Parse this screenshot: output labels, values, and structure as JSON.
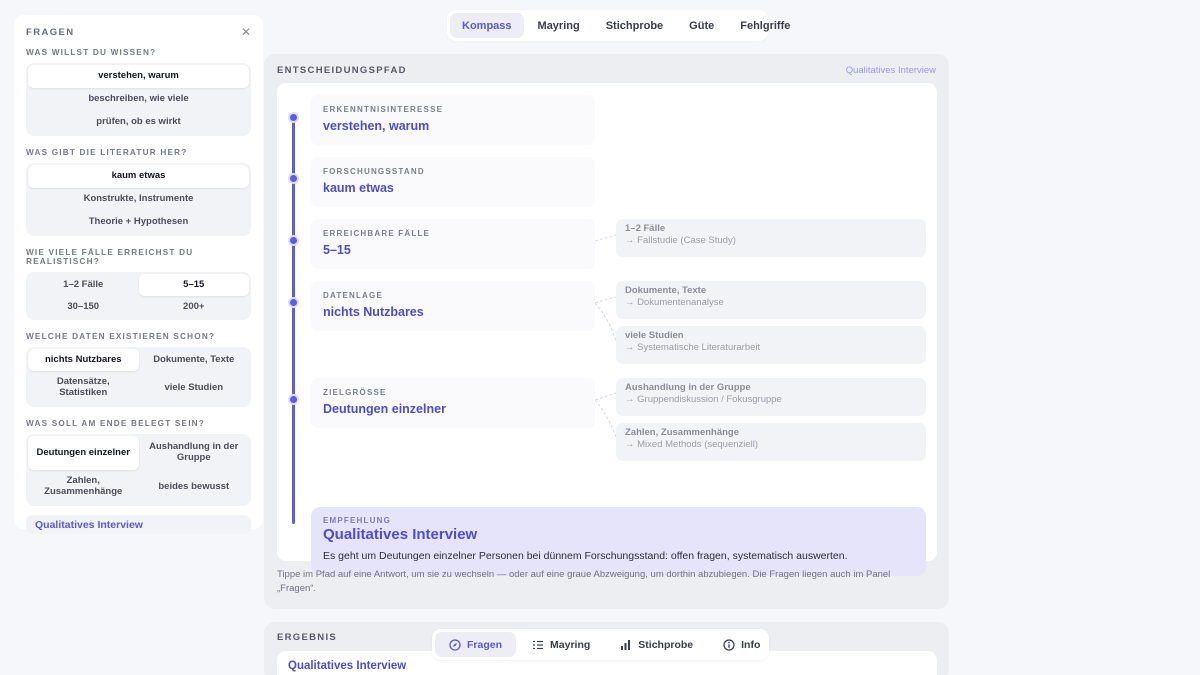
{
  "top_tabs": {
    "items": [
      "Kompass",
      "Mayring",
      "Stichprobe",
      "Güte",
      "Fehlgriffe"
    ],
    "active": "Kompass"
  },
  "panel": {
    "title": "FRAGEN",
    "close_icon": "close-icon",
    "questions": [
      {
        "label": "WAS WILLST DU WISSEN?",
        "options": [
          "verstehen, warum",
          "beschreiben, wie viele",
          "prüfen, ob es wirkt"
        ],
        "selected": "verstehen, warum"
      },
      {
        "label": "WAS GIBT DIE LITERATUR HER?",
        "options": [
          "kaum etwas",
          "Konstrukte, Instrumente",
          "Theorie + Hypothesen"
        ],
        "selected": "kaum etwas"
      },
      {
        "label": "WIE VIELE FÄLLE ERREICHST DU REALISTISCH?",
        "options": [
          "1–2 Fälle",
          "5–15",
          "30–150",
          "200+"
        ],
        "selected": "5–15"
      },
      {
        "label": "WELCHE DATEN EXISTIEREN SCHON?",
        "options": [
          "nichts Nutzbares",
          "Dokumente, Texte",
          "Datensätze, Statistiken",
          "viele Studien"
        ],
        "selected": "nichts Nutzbares"
      },
      {
        "label": "WAS SOLL AM ENDE BELEGT SEIN?",
        "options": [
          "Deutungen einzelner",
          "Aushandlung in der Gruppe",
          "Zahlen, Zusammenhänge",
          "beides bewusst"
        ],
        "selected": "Deutungen einzelner"
      }
    ],
    "result": "Qualitatives Interview"
  },
  "main": {
    "title": "ENTSCHEIDUNGSPFAD",
    "link": "Qualitatives Interview",
    "steps": [
      {
        "label": "ERKENNTNISINTERESSE",
        "value": "verstehen, warum"
      },
      {
        "label": "FORSCHUNGSSTAND",
        "value": "kaum etwas"
      },
      {
        "label": "ERREICHBARE FÄLLE",
        "value": "5–15"
      },
      {
        "label": "DATENLAGE",
        "value": "nichts Nutzbares"
      },
      {
        "label": "ZIELGRÖSSE",
        "value": "Deutungen einzelner"
      }
    ],
    "branches": [
      {
        "title": "1–2 Fälle",
        "target": "→ Fallstudie (Case Study)"
      },
      {
        "title": "Dokumente, Texte",
        "target": "→ Dokumentenanalyse"
      },
      {
        "title": "viele Studien",
        "target": "→ Systematische Literaturarbeit"
      },
      {
        "title": "Aushandlung in der Gruppe",
        "target": "→ Gruppendiskussion / Fokusgruppe"
      },
      {
        "title": "Zahlen, Zusammenhänge",
        "target": "→ Mixed Methods (sequenziell)"
      }
    ],
    "recommendation": {
      "label": "EMPFEHLUNG",
      "title": "Qualitatives Interview",
      "text": "Es geht um Deutungen einzelner Personen bei dünnem Forschungsstand: offen fragen, systematisch auswerten."
    },
    "hint": "Tippe im Pfad auf eine Antwort, um sie zu wechseln — oder auf eine graue Abzweigung, um dorthin abzubiegen. Die Fragen liegen auch im Panel „Fragen“."
  },
  "result": {
    "title": "ERGEBNIS",
    "name": "Qualitatives Interview"
  },
  "bottom_tabs": {
    "items": [
      {
        "label": "Fragen",
        "icon": "compass-icon"
      },
      {
        "label": "Mayring",
        "icon": "list-icon"
      },
      {
        "label": "Stichprobe",
        "icon": "bar-chart-icon"
      },
      {
        "label": "Info",
        "icon": "info-icon"
      }
    ],
    "active": "Fragen"
  },
  "colors": {
    "accent": "#5f5ce0",
    "accent_text": "#4f4cd0",
    "reco_bg": "#e6e4fb"
  }
}
